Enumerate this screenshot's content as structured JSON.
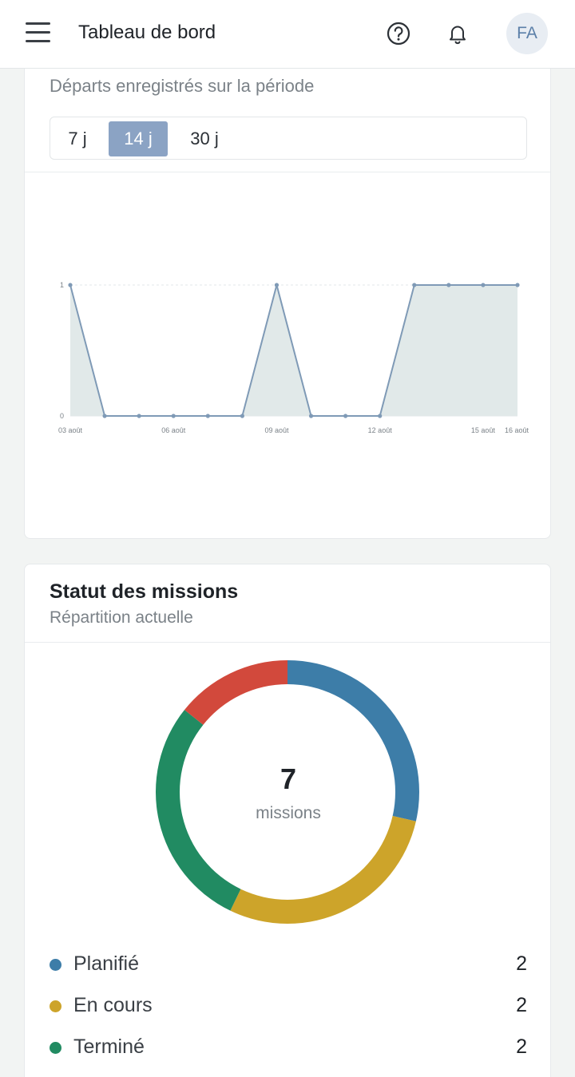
{
  "header": {
    "title": "Tableau de bord",
    "avatar_initials": "FA"
  },
  "departures_card": {
    "subtitle": "Départs enregistrés sur la période",
    "ranges": [
      "7 j",
      "14 j",
      "30 j"
    ],
    "selected_range": "14 j"
  },
  "chart_data": [
    {
      "type": "area",
      "x": [
        "03 août",
        "04 août",
        "05 août",
        "06 août",
        "07 août",
        "08 août",
        "09 août",
        "10 août",
        "11 août",
        "12 août",
        "13 août",
        "14 août",
        "15 août",
        "16 août"
      ],
      "x_tick_labels": [
        "03 août",
        "06 août",
        "09 août",
        "12 août",
        "15 août",
        "16 août"
      ],
      "values": [
        1,
        0,
        0,
        0,
        0,
        0,
        1,
        0,
        0,
        0,
        1,
        1,
        1,
        1
      ],
      "ylim": [
        0,
        1
      ],
      "y_ticks": [
        "0",
        "1"
      ],
      "color": "#7f9ab6",
      "fill": "#e1e9e9",
      "grid": true
    },
    {
      "type": "pie",
      "title": "Statut des missions",
      "subtitle": "Répartition actuelle",
      "total": "7",
      "total_label": "missions",
      "slices": [
        {
          "label": "Planifié",
          "value": 2,
          "color": "#3d7da8"
        },
        {
          "label": "En cours",
          "value": 2,
          "color": "#cda42a"
        },
        {
          "label": "Terminé",
          "value": 2,
          "color": "#218b62"
        },
        {
          "label": "",
          "value": 1,
          "color": "#d2493c"
        }
      ]
    }
  ],
  "status_legend": [
    {
      "label": "Planifié",
      "count": "2",
      "color": "#3d7da8"
    },
    {
      "label": "En cours",
      "count": "2",
      "color": "#cda42a"
    },
    {
      "label": "Terminé",
      "count": "2",
      "color": "#218b62"
    }
  ]
}
